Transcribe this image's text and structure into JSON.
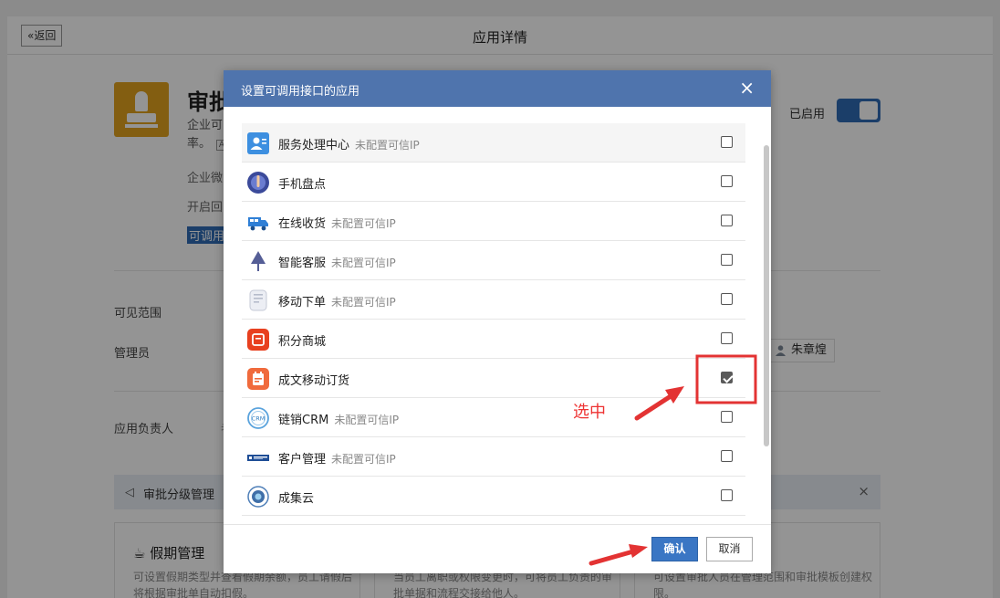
{
  "topbar": {
    "back_label": "返回",
    "back_glyph": "«",
    "title": "应用详情"
  },
  "app": {
    "name": "审批",
    "desc_line1": "企业可",
    "desc_line2": "率。",
    "desc_tag": "A",
    "line1": "企业微",
    "line2": "开启回",
    "line3": "可调用",
    "enabled_label": "已启用",
    "enabled": true
  },
  "fields": {
    "visible_range": "可见范围",
    "admin": "管理员",
    "owner": "应用负责人",
    "owner_value": "者",
    "admin_user": "朱章煌"
  },
  "notice": {
    "text": "审批分级管理",
    "close": "×"
  },
  "cards": [
    {
      "title": "假期管理",
      "desc": "可设置假期类型并查看假期余额，员工请假后将根据审批单自动扣假。"
    },
    {
      "title": "",
      "desc": "当员工离职或权限变更时，可将员工负责的审批单据和流程交接给他人。"
    },
    {
      "title": "",
      "desc": "可设置审批人员在管理范围和审批模板创建权限。"
    }
  ],
  "dialog": {
    "title": "设置可调用接口的应用",
    "close": "×",
    "items": [
      {
        "name": "服务处理中心",
        "sub": "未配置可信IP",
        "checked": false,
        "icon": "service-center-icon"
      },
      {
        "name": "手机盘点",
        "sub": "",
        "checked": false,
        "icon": "phone-inventory-icon"
      },
      {
        "name": "在线收货",
        "sub": "未配置可信IP",
        "checked": false,
        "icon": "delivery-truck-icon"
      },
      {
        "name": "智能客服",
        "sub": "未配置可信IP",
        "checked": false,
        "icon": "smart-service-icon"
      },
      {
        "name": "移动下单",
        "sub": "未配置可信IP",
        "checked": false,
        "icon": "mobile-order-icon"
      },
      {
        "name": "积分商城",
        "sub": "",
        "checked": false,
        "icon": "points-mall-icon"
      },
      {
        "name": "成文移动订货",
        "sub": "",
        "checked": true,
        "icon": "mobile-ordering-icon"
      },
      {
        "name": "链销CRM",
        "sub": "未配置可信IP",
        "checked": false,
        "icon": "crm-icon"
      },
      {
        "name": "客户管理",
        "sub": "未配置可信IP",
        "checked": false,
        "icon": "customer-management-icon"
      },
      {
        "name": "成集云",
        "sub": "",
        "checked": false,
        "icon": "chengji-cloud-icon"
      }
    ],
    "confirm_label": "确认",
    "cancel_label": "取消"
  },
  "annotation": {
    "label": "选中",
    "color": "#e33333"
  },
  "colors": {
    "header": "#4f74ad",
    "confirm": "#3a76c4",
    "toggle": "#2f6bb5",
    "app_icon": "#e2a31e"
  }
}
